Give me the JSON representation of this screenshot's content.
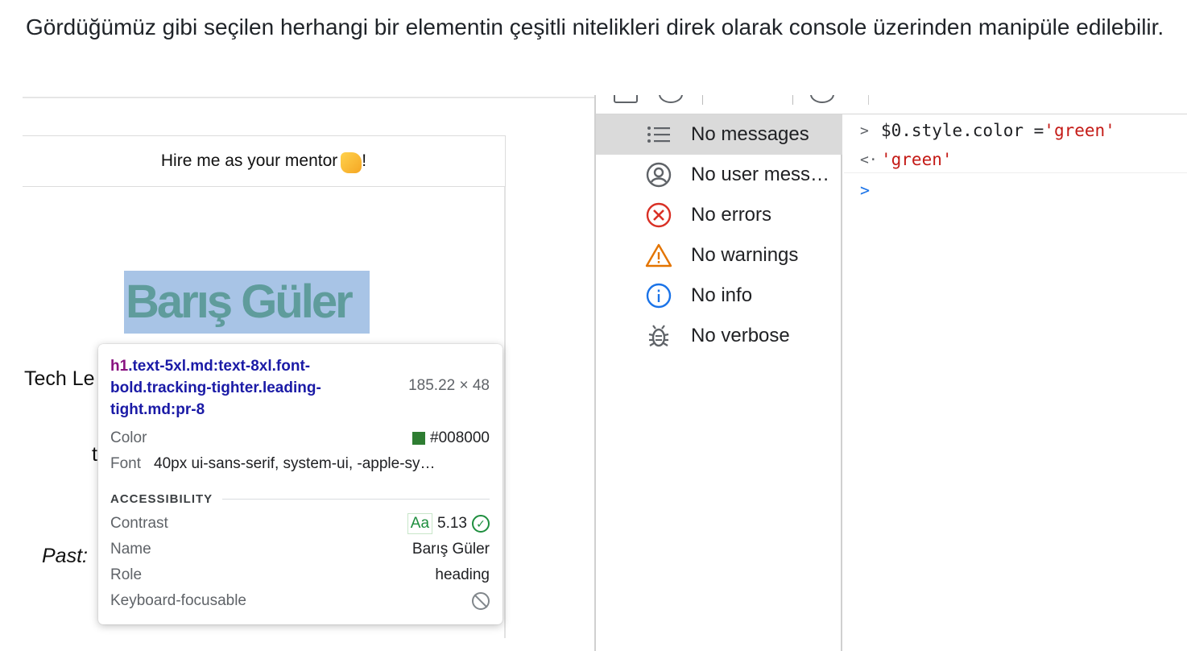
{
  "intro": {
    "text": "Gördüğümüz gibi seçilen herhangi bir elementin çeşitli nitelikleri direk olarak console üzerinden manipüle edilebilir."
  },
  "page": {
    "mentor_bar": "Hire me as your mentor",
    "mentor_bar_suffix": "!",
    "heading": "Barış Güler",
    "fragment_tech": "Tech Le",
    "fragment_t": "t",
    "fragment_past": "Past:"
  },
  "tooltip": {
    "tag": "h1",
    "selector": ".text-5xl.md:text-8xl.font-bold.tracking-tighter.leading-tight.md:pr-8",
    "size": "185.22 × 48",
    "color_label": "Color",
    "color_value": "#008000",
    "swatch_color": "#2e7d32",
    "font_label": "Font",
    "font_value": "40px ui-sans-serif, system-ui, -apple-sy…",
    "accessibility_title": "ACCESSIBILITY",
    "contrast_label": "Contrast",
    "contrast_aa": "Aa",
    "contrast_value": "5.13",
    "name_label": "Name",
    "name_value": "Barış Güler",
    "role_label": "Role",
    "role_value": "heading",
    "keyboard_label": "Keyboard-focusable"
  },
  "devtools": {
    "sidebar": [
      {
        "label": "No messages",
        "icon": "list-icon"
      },
      {
        "label": "No user mess…",
        "icon": "user-icon"
      },
      {
        "label": "No errors",
        "icon": "error-icon"
      },
      {
        "label": "No warnings",
        "icon": "warning-icon"
      },
      {
        "label": "No info",
        "icon": "info-icon"
      },
      {
        "label": "No verbose",
        "icon": "bug-icon"
      }
    ],
    "console": {
      "input_prompt": ">",
      "input_code": "$0.style.color = ",
      "input_string": "'green'",
      "output_prompt": "<·",
      "output_string": "'green'",
      "caret": ">"
    },
    "colors": {
      "error": "#d93025",
      "warning": "#e37400",
      "info": "#1a73e8",
      "string": "#c41a16"
    }
  }
}
